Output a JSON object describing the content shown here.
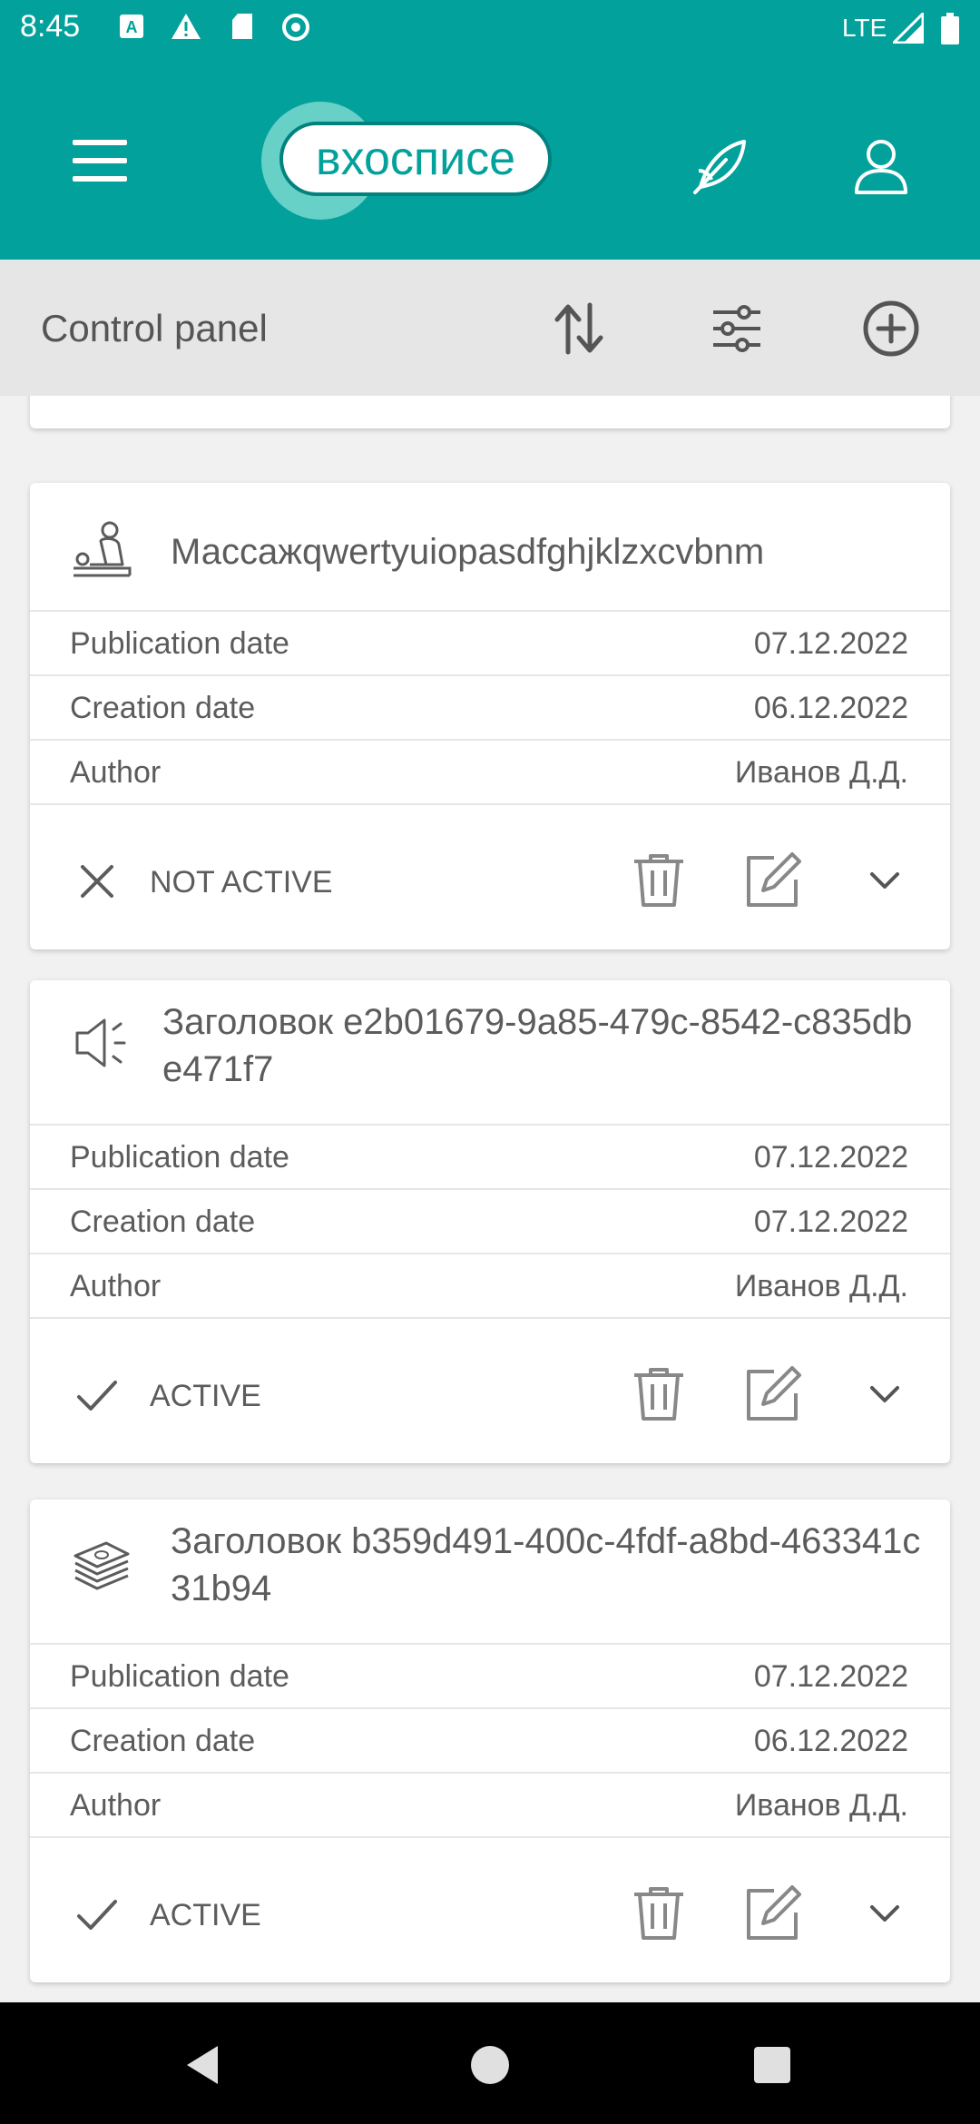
{
  "status_bar": {
    "time": "8:45",
    "network": "LTE"
  },
  "app_bar": {
    "logo_text": "вхосписе"
  },
  "control_bar": {
    "title": "Control panel"
  },
  "labels": {
    "publication_date": "Publication date",
    "creation_date": "Creation date",
    "author": "Author"
  },
  "cards": [
    {
      "icon": "massage-icon",
      "title": "Массажqwertyuiopasdfghjklzxcvbnm",
      "publication_date": "07.12.2022",
      "creation_date": "06.12.2022",
      "author": "Иванов Д.Д.",
      "status": "NOT ACTIVE",
      "status_icon": "close-icon"
    },
    {
      "icon": "speaker-icon",
      "title": "Заголовок e2b01679-9a85-479c-8542-c835dbe471f7",
      "publication_date": "07.12.2022",
      "creation_date": "07.12.2022",
      "author": "Иванов Д.Д.",
      "status": "ACTIVE",
      "status_icon": "check-icon"
    },
    {
      "icon": "money-icon",
      "title": "Заголовок b359d491-400c-4fdf-a8bd-463341c31b94",
      "publication_date": "07.12.2022",
      "creation_date": "06.12.2022",
      "author": "Иванов Д.Д.",
      "status": "ACTIVE",
      "status_icon": "check-icon"
    }
  ],
  "colors": {
    "primary": "#03a19c",
    "accent_light": "#67d0c7",
    "text": "#5c5c5c"
  }
}
